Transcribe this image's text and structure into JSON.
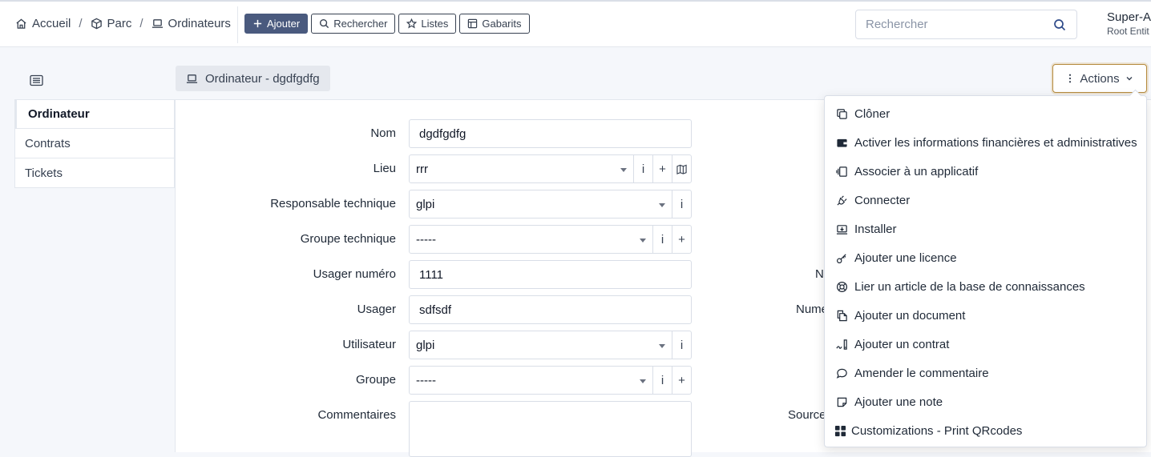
{
  "breadcrumb": {
    "home": "Accueil",
    "parc": "Parc",
    "ordinateurs": "Ordinateurs",
    "separator": "/"
  },
  "toolbar": {
    "add": "Ajouter",
    "search": "Rechercher",
    "lists": "Listes",
    "templates": "Gabarits"
  },
  "search": {
    "placeholder": "Rechercher"
  },
  "user": {
    "name": "Super-A",
    "entity": "Root Entit"
  },
  "sidenav": {
    "items": [
      {
        "label": "Ordinateur",
        "active": true
      },
      {
        "label": "Contrats"
      },
      {
        "label": "Tickets"
      }
    ]
  },
  "title": "Ordinateur - dgdfgdfg",
  "actions_label": "Actions",
  "form": {
    "nom": {
      "label": "Nom",
      "value": "dgdfgdfg"
    },
    "lieu": {
      "label": "Lieu",
      "value": "rrr"
    },
    "responsable": {
      "label": "Responsable technique",
      "value": "glpi"
    },
    "groupe_tech": {
      "label": "Groupe technique",
      "value": "-----"
    },
    "usager_numero": {
      "label": "Usager numéro",
      "value": "1111"
    },
    "usager": {
      "label": "Usager",
      "value": "sdfsdf"
    },
    "utilisateur": {
      "label": "Utilisateur",
      "value": "glpi"
    },
    "groupe": {
      "label": "Groupe",
      "value": "-----"
    },
    "commentaires": {
      "label": "Commentaires",
      "value": ""
    }
  },
  "addons": {
    "info": "i",
    "plus": "+"
  },
  "right_labels": {
    "n": "N",
    "nume": "Nume",
    "source": "Source"
  },
  "dropdown": {
    "items": [
      {
        "label": "Clôner",
        "icon": "clone-icon"
      },
      {
        "label": "Activer les informations financières et administratives",
        "icon": "wallet-icon"
      },
      {
        "label": "Associer à un applicatif",
        "icon": "app-icon"
      },
      {
        "label": "Connecter",
        "icon": "plug-icon"
      },
      {
        "label": "Installer",
        "icon": "install-icon"
      },
      {
        "label": "Ajouter une licence",
        "icon": "key-icon"
      },
      {
        "label": "Lier un article de la base de connaissances",
        "icon": "lifebuoy-icon"
      },
      {
        "label": "Ajouter un document",
        "icon": "files-icon"
      },
      {
        "label": "Ajouter un contrat",
        "icon": "contract-icon"
      },
      {
        "label": "Amender le commentaire",
        "icon": "comment-icon"
      },
      {
        "label": "Ajouter une note",
        "icon": "note-icon"
      },
      {
        "label": "Customizations - Print QRcodes",
        "icon": "qrcode-icon"
      }
    ]
  },
  "colors": {
    "primary_button": "#4a5a7e",
    "actions_border": "#b58a3c",
    "page_bg": "#f5f7fb"
  }
}
